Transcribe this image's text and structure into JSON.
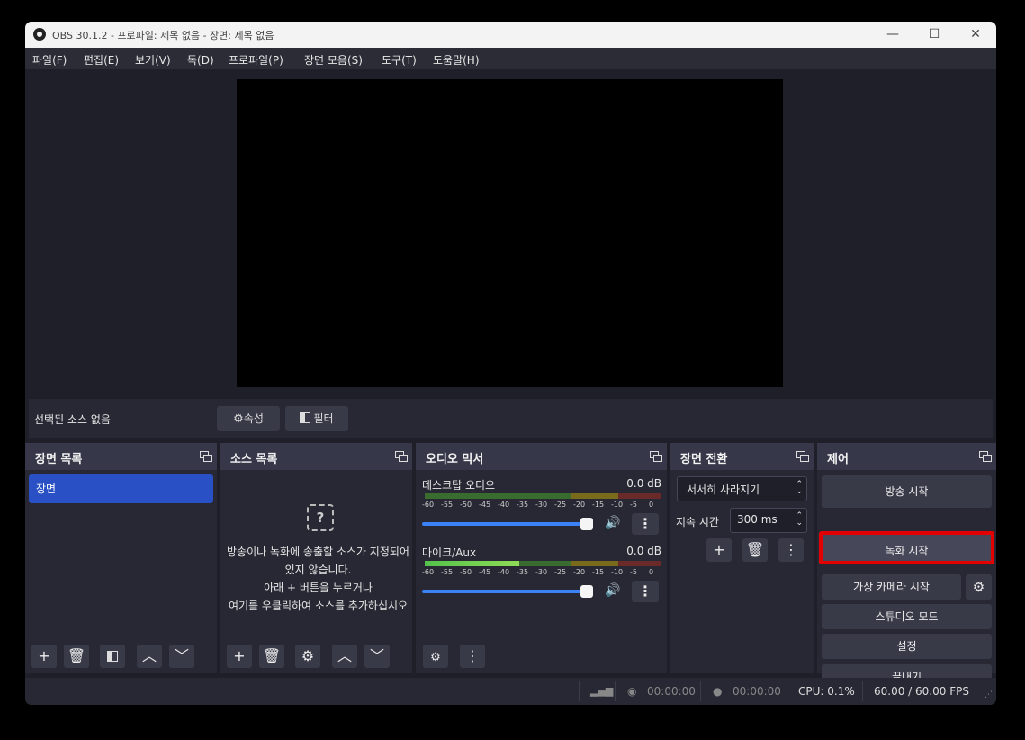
{
  "window": {
    "title": "OBS 30.1.2 - 프로파일: 제목 없음 - 장면: 제목 없음",
    "minimize": "—",
    "maximize": "☐",
    "close": "✕"
  },
  "menu": [
    "파일(F)",
    "편집(E)",
    "보기(V)",
    "독(D)",
    "프로파일(P)",
    "장면 모음(S)",
    "도구(T)",
    "도움말(H)"
  ],
  "context_bar": {
    "no_source": "선택된 소스 없음",
    "properties": "속성",
    "filters": "필터"
  },
  "docks": {
    "scenes": {
      "title": "장면 목록",
      "items": [
        "장면"
      ]
    },
    "sources": {
      "title": "소스 목록",
      "empty_lines": [
        "방송이나 녹화에 송출할 소스가 지정되어",
        "있지 않습니다.",
        "아래 + 버튼을 누르거나",
        "여기를 우클릭하여 소스를 추가하십시오"
      ]
    },
    "mixer": {
      "title": "오디오 믹서",
      "channels": [
        {
          "name": "데스크탑 오디오",
          "db": "0.0 dB",
          "level": 0.0,
          "volume": 1.0
        },
        {
          "name": "마이크/Aux",
          "db": "0.0 dB",
          "level": 0.4,
          "volume": 1.0
        }
      ],
      "ticks": [
        "-60",
        "-55",
        "-50",
        "-45",
        "-40",
        "-35",
        "-30",
        "-25",
        "-20",
        "-15",
        "-10",
        "-5",
        "0"
      ]
    },
    "transitions": {
      "title": "장면 전환",
      "transition": "서서히 사라지기",
      "duration_label": "지속 시간",
      "duration": "300 ms"
    },
    "controls": {
      "title": "제어",
      "start_stream": "방송 시작",
      "start_record": "녹화 시작",
      "start_virtualcam": "가상 카메라 시작",
      "studio_mode": "스튜디오 모드",
      "settings": "설정",
      "exit": "끝내기"
    }
  },
  "status": {
    "stream_time": "00:00:00",
    "record_time": "00:00:00",
    "cpu": "CPU: 0.1%",
    "fps": "60.00 / 60.00 FPS"
  },
  "colors": {
    "highlight": "#e30000",
    "selected_scene": "#2a50c5",
    "slider": "#3b82f6"
  }
}
